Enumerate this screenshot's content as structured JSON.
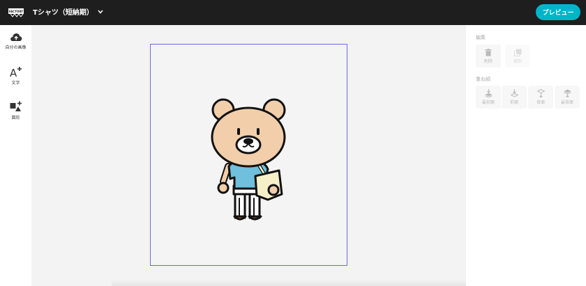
{
  "header": {
    "logo_text": "FACTORY",
    "product_name": "Tシャツ（短納期）",
    "preview_label": "プレビュー"
  },
  "sidebar": {
    "items": [
      {
        "label": "自分の画像",
        "icon": "cloud-upload-icon"
      },
      {
        "label": "文字",
        "icon": "add-text-icon"
      },
      {
        "label": "図形",
        "icon": "add-shape-icon"
      }
    ]
  },
  "panel": {
    "edit_title": "編集",
    "delete_label": "削除",
    "copy_label": "複製",
    "layer_title": "重ね順",
    "layer_buttons": [
      "最前面",
      "前面",
      "背面",
      "最背面"
    ]
  },
  "colors": {
    "topbar": "#1e1e1e",
    "accent": "#00b5c9",
    "print_area_border": "#6a6adf",
    "bear_fur": "#f2cfaa",
    "shirt": "#6ec0dc"
  }
}
